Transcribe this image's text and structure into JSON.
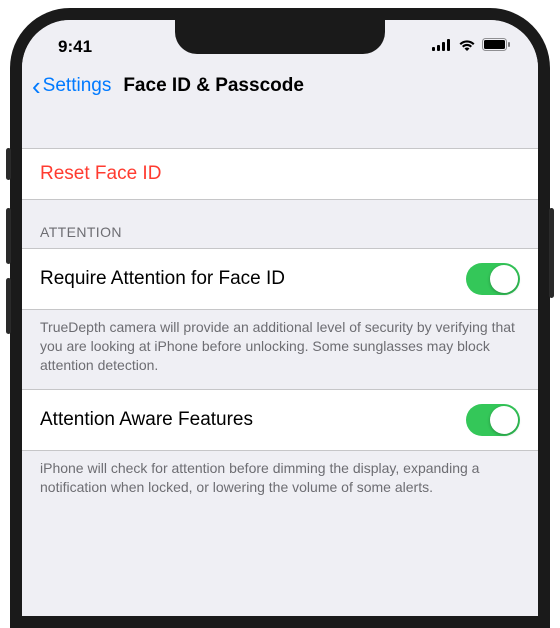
{
  "status": {
    "time": "9:41"
  },
  "nav": {
    "back_label": "Settings",
    "title": "Face ID & Passcode"
  },
  "reset": {
    "label": "Reset Face ID"
  },
  "attention": {
    "header": "ATTENTION",
    "require_label": "Require Attention for Face ID",
    "require_footer": "TrueDepth camera will provide an additional level of security by verifying that you are looking at iPhone before unlocking. Some sunglasses may block attention detection.",
    "aware_label": "Attention Aware Features",
    "aware_footer": "iPhone will check for attention before dimming the display, expanding a notification when locked, or lowering the volume of some alerts."
  }
}
